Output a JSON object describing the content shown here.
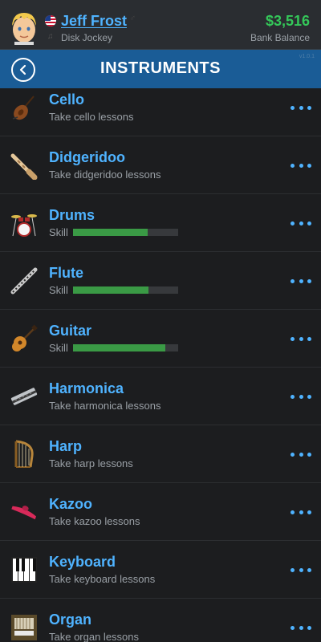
{
  "header": {
    "name": "Jeff Frost",
    "job": "Disk Jockey",
    "balance": "$3,516",
    "balance_label": "Bank Balance"
  },
  "titlebar": {
    "title": "INSTRUMENTS",
    "watermark": "v1.0.1"
  },
  "instruments": [
    {
      "name": "Cello",
      "sub": "Take cello lessons",
      "icon": "cello-icon",
      "skill": null
    },
    {
      "name": "Didgeridoo",
      "sub": "Take didgeridoo lessons",
      "icon": "didgeridoo-icon",
      "skill": null
    },
    {
      "name": "Drums",
      "sub": "Skill",
      "icon": "drums-icon",
      "skill": 0.71
    },
    {
      "name": "Flute",
      "sub": "Skill",
      "icon": "flute-icon",
      "skill": 0.72
    },
    {
      "name": "Guitar",
      "sub": "Skill",
      "icon": "guitar-icon",
      "skill": 0.88
    },
    {
      "name": "Harmonica",
      "sub": "Take harmonica lessons",
      "icon": "harmonica-icon",
      "skill": null
    },
    {
      "name": "Harp",
      "sub": "Take harp lessons",
      "icon": "harp-icon",
      "skill": null
    },
    {
      "name": "Kazoo",
      "sub": "Take kazoo lessons",
      "icon": "kazoo-icon",
      "skill": null
    },
    {
      "name": "Keyboard",
      "sub": "Take keyboard lessons",
      "icon": "keyboard-icon",
      "skill": null
    },
    {
      "name": "Organ",
      "sub": "Take organ lessons",
      "icon": "organ-icon",
      "skill": null
    }
  ],
  "colors": {
    "accent": "#4fb3ff",
    "title_bar": "#1a5c96",
    "balance": "#34c759",
    "skill_fill": "#3a9a45"
  }
}
